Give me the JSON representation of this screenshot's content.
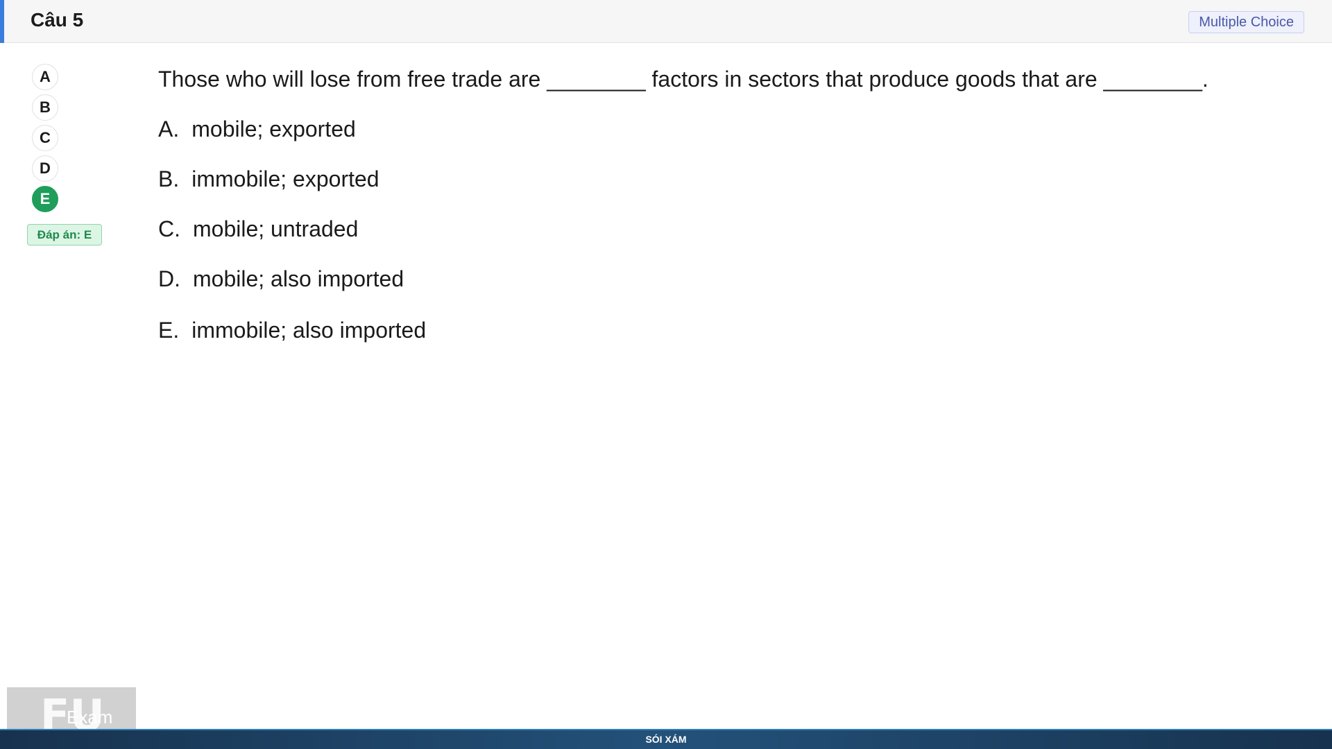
{
  "header": {
    "title": "Câu 5",
    "badge": "Multiple Choice"
  },
  "choices": [
    "A",
    "B",
    "C",
    "D",
    "E"
  ],
  "selected_choice": "E",
  "answer_label": "Đáp án: E",
  "question": {
    "text": "Those who will lose from free trade are ________ factors in sectors that produce goods that are ________.",
    "options": [
      {
        "letter": "A.",
        "text": "mobile; exported"
      },
      {
        "letter": "B.",
        "text": "immobile; exported"
      },
      {
        "letter": "C.",
        "text": "mobile; untraded"
      },
      {
        "letter": "D.",
        "text": "mobile; also imported"
      },
      {
        "letter": "E.",
        "text": "immobile; also imported"
      }
    ]
  },
  "logo": {
    "mark": "FU",
    "text": "Exam"
  },
  "footer": {
    "label": "SÓI XÁM"
  },
  "colors": {
    "accent": "#3b7ddd",
    "selected": "#1e9e5a",
    "badge_text": "#4a58a8",
    "footer_bg": "#1d4063"
  }
}
